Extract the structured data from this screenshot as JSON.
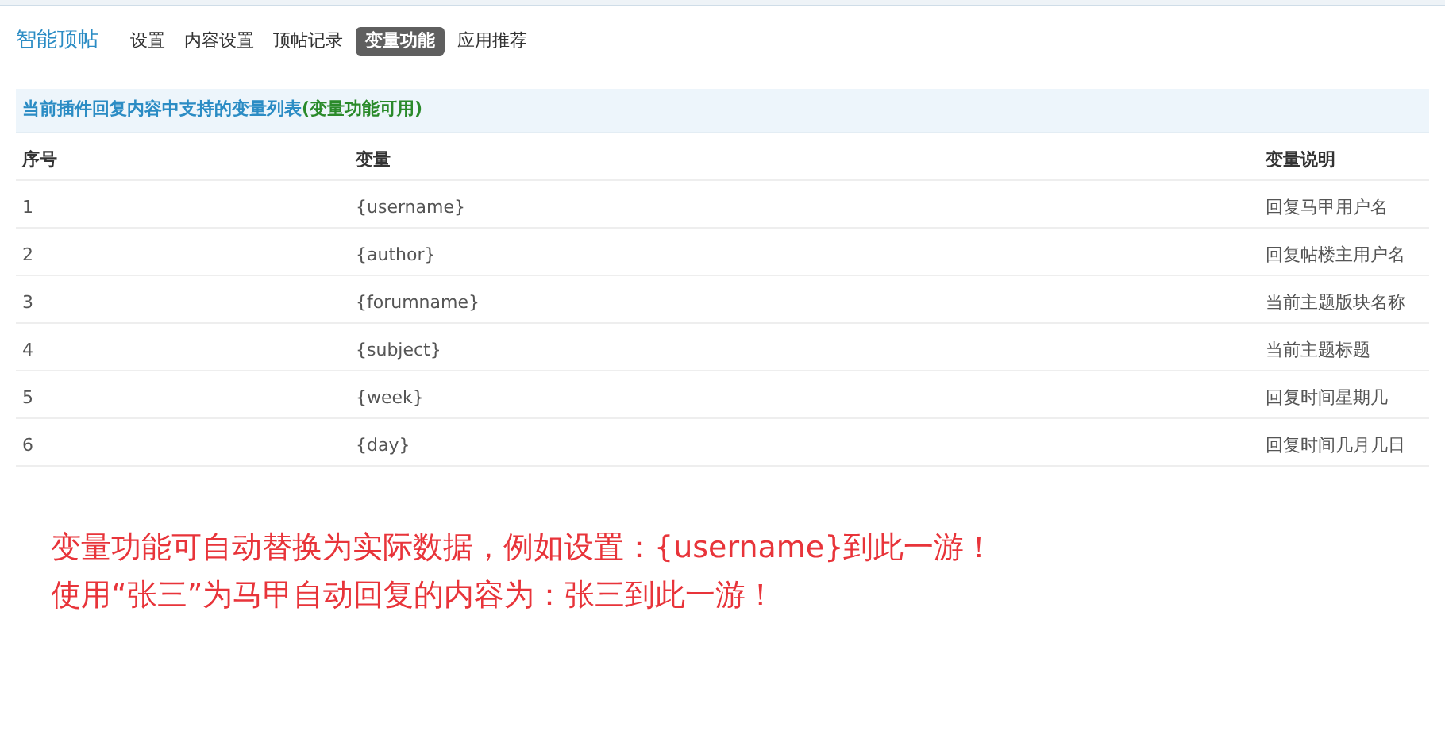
{
  "plugin_title": "智能顶帖",
  "tabs": [
    {
      "label": "设置",
      "selected": false
    },
    {
      "label": "内容设置",
      "selected": false
    },
    {
      "label": "顶帖记录",
      "selected": false
    },
    {
      "label": "变量功能",
      "selected": true
    },
    {
      "label": "应用推荐",
      "selected": false
    }
  ],
  "section_header": {
    "title": "当前插件回复内容中支持的变量列表",
    "status": "(变量功能可用)"
  },
  "table": {
    "columns": [
      "序号",
      "变量",
      "变量说明"
    ],
    "rows": [
      [
        "1",
        "{username}",
        "回复马甲用户名"
      ],
      [
        "2",
        "{author}",
        "回复帖楼主用户名"
      ],
      [
        "3",
        "{forumname}",
        "当前主题版块名称"
      ],
      [
        "4",
        "{subject}",
        "当前主题标题"
      ],
      [
        "5",
        "{week}",
        "回复时间星期几"
      ],
      [
        "6",
        "{day}",
        "回复时间几月几日"
      ]
    ]
  },
  "annotation": [
    "变量功能可自动替换为实际数据，例如设置：{username}到此一游！",
    "使用“张三”为马甲自动回复的内容为：张三到此一游！"
  ]
}
